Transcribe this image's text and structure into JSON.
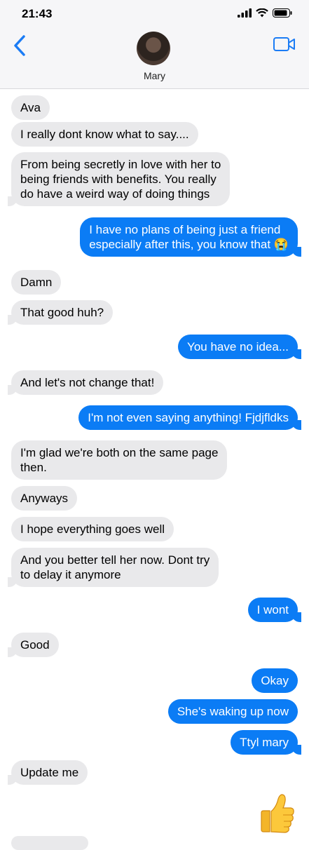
{
  "status": {
    "time": "21:43"
  },
  "header": {
    "contact_name": "Mary"
  },
  "messages": [
    {
      "from": "them",
      "text": "Ava"
    },
    {
      "from": "them",
      "text": "I really dont know what to say...."
    },
    {
      "from": "them",
      "text": "From being secretly in love with her to\nbeing friends with benefits. You really\ndo have a weird way of doing things"
    },
    {
      "from": "me",
      "text": "I have no plans of being just a friend\nespecially after this, you know that 😭"
    },
    {
      "from": "them",
      "text": "Damn"
    },
    {
      "from": "them",
      "text": "That good huh?"
    },
    {
      "from": "me",
      "text": "You have no idea..."
    },
    {
      "from": "them",
      "text": "And let's not change that!"
    },
    {
      "from": "me",
      "text": "I'm not even saying anything! Fjdjfldks"
    },
    {
      "from": "them",
      "text": "I'm glad we're both on the same page\nthen."
    },
    {
      "from": "them",
      "text": "Anyways"
    },
    {
      "from": "them",
      "text": "I hope everything goes well"
    },
    {
      "from": "them",
      "text": "And you better tell her now. Dont try\nto delay it anymore"
    },
    {
      "from": "me",
      "text": "I wont"
    },
    {
      "from": "them",
      "text": "Good"
    },
    {
      "from": "me",
      "text": "Okay"
    },
    {
      "from": "me",
      "text": "She's waking up now"
    },
    {
      "from": "me",
      "text": "Ttyl mary"
    },
    {
      "from": "them",
      "text": "Update me"
    }
  ],
  "reaction": {
    "emoji": "👍"
  },
  "colors": {
    "sent_bubble": "#0b7cf5",
    "received_bubble": "#e9e9eb",
    "accent": "#1b7cf5"
  }
}
